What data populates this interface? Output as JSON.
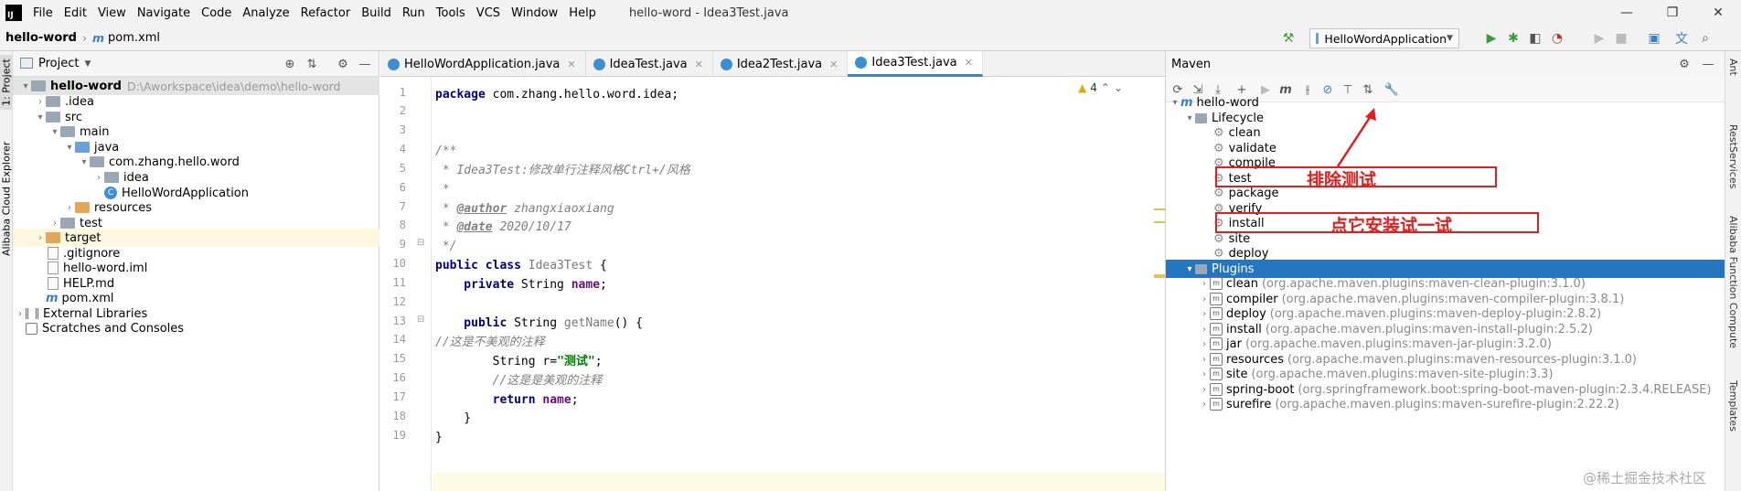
{
  "menu": {
    "logo": "IJ",
    "items": [
      "File",
      "Edit",
      "View",
      "Navigate",
      "Code",
      "Analyze",
      "Refactor",
      "Build",
      "Run",
      "Tools",
      "VCS",
      "Window",
      "Help"
    ],
    "window_title": "hello-word - Idea3Test.java",
    "minimize": "—",
    "maximize": "❐",
    "close": "✕"
  },
  "navbar": {
    "project": "hello-word",
    "separator": "›",
    "file": "pom.xml",
    "run_config": "HelloWordApplication"
  },
  "left_strip": {
    "project_tab": "1: Project",
    "cloud_tab": "Alibaba Cloud Explorer"
  },
  "right_strip": {
    "tab_ant": "Ant",
    "tab_request": "RestServices",
    "tab_cloud": "Alibaba Function Compute",
    "tab_ros": "Alibaba ROS Templates"
  },
  "project_panel": {
    "title": "Project",
    "tree": [
      {
        "label": "hello-word",
        "path": "D:\\Aworkspace\\idea\\demo\\hello-word",
        "bold": true
      },
      {
        "label": ".idea"
      },
      {
        "label": "src"
      },
      {
        "label": "main"
      },
      {
        "label": "java"
      },
      {
        "label": "com.zhang.hello.word"
      },
      {
        "label": "idea"
      },
      {
        "label": "HelloWordApplication"
      },
      {
        "label": "resources"
      },
      {
        "label": "test"
      },
      {
        "label": "target"
      },
      {
        "label": ".gitignore"
      },
      {
        "label": "hello-word.iml"
      },
      {
        "label": "HELP.md"
      },
      {
        "label": "pom.xml"
      },
      {
        "label": "External Libraries"
      },
      {
        "label": "Scratches and Consoles"
      }
    ]
  },
  "editor": {
    "tabs": [
      "HelloWordApplication.java",
      "IdeaTest.java",
      "Idea2Test.java",
      "Idea3Test.java"
    ],
    "active_tab": "Idea3Test.java",
    "warnings": "4",
    "line_numbers": [
      "1",
      "2",
      "3",
      "4",
      "5",
      "6",
      "7",
      "8",
      "9",
      "10",
      "11",
      "12",
      "13",
      "14",
      "15",
      "16",
      "17",
      "18",
      "19"
    ],
    "lines": {
      "l1_kw": "package",
      "l1_rest": " com.zhang.hello.word.idea;",
      "l3": "/**",
      "l4": " * Idea3Test:修改单行注释风格Ctrl+/风格",
      "l5": " *",
      "l6_tag": "@author",
      "l6_rest": " zhangxiaoxiang",
      "l7_tag": "@date",
      "l7_rest": " 2020/10/17",
      "l8": " */",
      "l9_kw": "public class",
      "l9_name": " Idea3Test",
      "l9_rest": " {",
      "l10_kw": "    private",
      "l10_type": " String ",
      "l10_field": "name",
      "l10_end": ";",
      "l12_kw": "    public",
      "l12_rest": " String ",
      "l12_method": "getName",
      "l12_end": "() {",
      "l13": "//这是不美观的注释",
      "l14_type": "        String r=",
      "l14_str": "\"测试\"",
      "l14_end": ";",
      "l15": "        //这是是美观的注释",
      "l16_kw": "        return",
      "l16_field": " name",
      "l16_end": ";",
      "l17": "    }",
      "l18": "}"
    }
  },
  "maven": {
    "title": "Maven",
    "project": "hello-word",
    "lifecycle_label": "Lifecycle",
    "lifecycle": [
      "clean",
      "validate",
      "compile",
      "test",
      "package",
      "verify",
      "install",
      "site",
      "deploy"
    ],
    "plugins_label": "Plugins",
    "plugins": [
      {
        "name": "clean",
        "coord": "(org.apache.maven.plugins:maven-clean-plugin:3.1.0)"
      },
      {
        "name": "compiler",
        "coord": "(org.apache.maven.plugins:maven-compiler-plugin:3.8.1)"
      },
      {
        "name": "deploy",
        "coord": "(org.apache.maven.plugins:maven-deploy-plugin:2.8.2)"
      },
      {
        "name": "install",
        "coord": "(org.apache.maven.plugins:maven-install-plugin:2.5.2)"
      },
      {
        "name": "jar",
        "coord": "(org.apache.maven.plugins:maven-jar-plugin:3.2.0)"
      },
      {
        "name": "resources",
        "coord": "(org.apache.maven.plugins:maven-resources-plugin:3.1.0)"
      },
      {
        "name": "site",
        "coord": "(org.apache.maven.plugins:maven-site-plugin:3.3)"
      },
      {
        "name": "spring-boot",
        "coord": "(org.springframework.boot:spring-boot-maven-plugin:2.3.4.RELEASE)"
      },
      {
        "name": "surefire",
        "coord": "(org.apache.maven.plugins:maven-surefire-plugin:2.22.2)"
      }
    ],
    "annotation_skip_test": "排除测试",
    "annotation_install": "点它安装试一试"
  },
  "watermark": "@稀土掘金技术社区",
  "colors": {
    "accent": "#2675bf",
    "annotation": "#e02020"
  }
}
